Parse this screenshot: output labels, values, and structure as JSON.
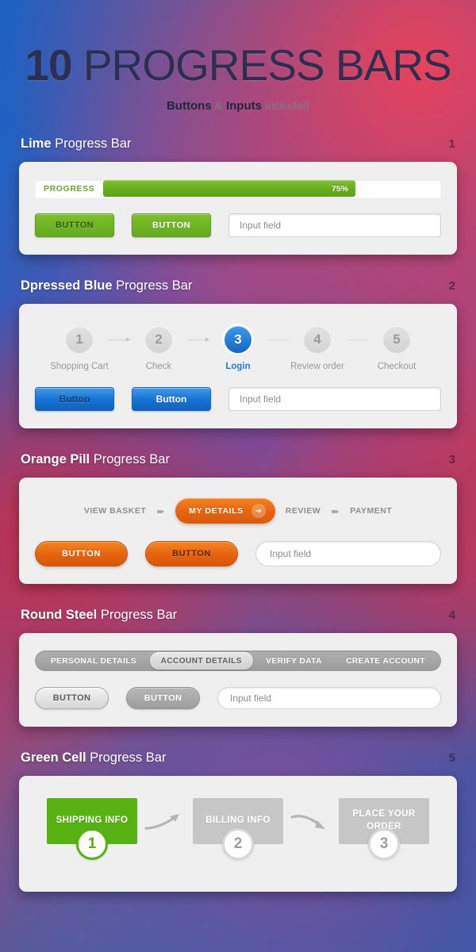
{
  "header": {
    "title_number": "10",
    "title_rest": " PROGRESS BARS",
    "sub_bold1": "Buttons",
    "sub_amp": " & ",
    "sub_bold2": "Inputs",
    "sub_light": " included"
  },
  "common": {
    "input_placeholder": "Input field"
  },
  "sections": [
    {
      "number": "1",
      "name_bold": "Lime",
      "name_rest": " Progress Bar",
      "accent": "#68ae1f",
      "progress": {
        "label": "PROGRESS",
        "percent_text": "75%",
        "percent_value": 75
      },
      "buttons": [
        {
          "label": "BUTTON",
          "style": "dark"
        },
        {
          "label": "BUTTON",
          "style": "white"
        }
      ],
      "input_value": "Input field"
    },
    {
      "number": "2",
      "name_bold": "Dpressed Blue",
      "name_rest": " Progress Bar",
      "accent": "#1872d2",
      "steps": [
        {
          "num": "1",
          "label": "Shopping Cart",
          "active": false
        },
        {
          "num": "2",
          "label": "Check",
          "active": false
        },
        {
          "num": "3",
          "label": "Login",
          "active": true
        },
        {
          "num": "4",
          "label": "Review order",
          "active": false
        },
        {
          "num": "5",
          "label": "Checkout",
          "active": false
        }
      ],
      "buttons": [
        {
          "label": "Button",
          "style": "dark"
        },
        {
          "label": "Button",
          "style": "white"
        }
      ],
      "input_value": "Input field"
    },
    {
      "number": "3",
      "name_bold": "Orange Pill",
      "name_rest": " Progress Bar",
      "accent": "#e5620e",
      "steps": [
        {
          "label": "VIEW BASKET",
          "active": false
        },
        {
          "label": "MY DETAILS",
          "active": true
        },
        {
          "label": "REVIEW",
          "active": false
        },
        {
          "label": "PAYMENT",
          "active": false
        }
      ],
      "arrow_glyph": "➨",
      "pill_arrow_glyph": "➜",
      "buttons": [
        {
          "label": "BUTTON",
          "style": "white"
        },
        {
          "label": "BUTTON",
          "style": "dark"
        }
      ],
      "input_value": "Input field"
    },
    {
      "number": "4",
      "name_bold": "Round Steel",
      "name_rest": " Progress Bar",
      "accent": "#9b9b9b",
      "steps": [
        {
          "label": "PERSONAL DETAILS",
          "active": false
        },
        {
          "label": "ACCOUNT DETAILS",
          "active": true
        },
        {
          "label": "VERIFY DATA",
          "active": false
        },
        {
          "label": "CREATE ACCOUNT",
          "active": false
        }
      ],
      "buttons": [
        {
          "label": "BUTTON",
          "style": "light"
        },
        {
          "label": "BUTTON",
          "style": "gray"
        }
      ],
      "input_value": "Input field"
    },
    {
      "number": "5",
      "name_bold": "Green Cell",
      "name_rest": " Progress Bar",
      "accent": "#57b211",
      "cells": [
        {
          "label": "SHIPPING INFO",
          "badge": "1",
          "active": true
        },
        {
          "label": "BILLING INFO",
          "badge": "2",
          "active": false
        },
        {
          "label": "PLACE YOUR ORDER",
          "badge": "3",
          "active": false
        }
      ]
    }
  ]
}
